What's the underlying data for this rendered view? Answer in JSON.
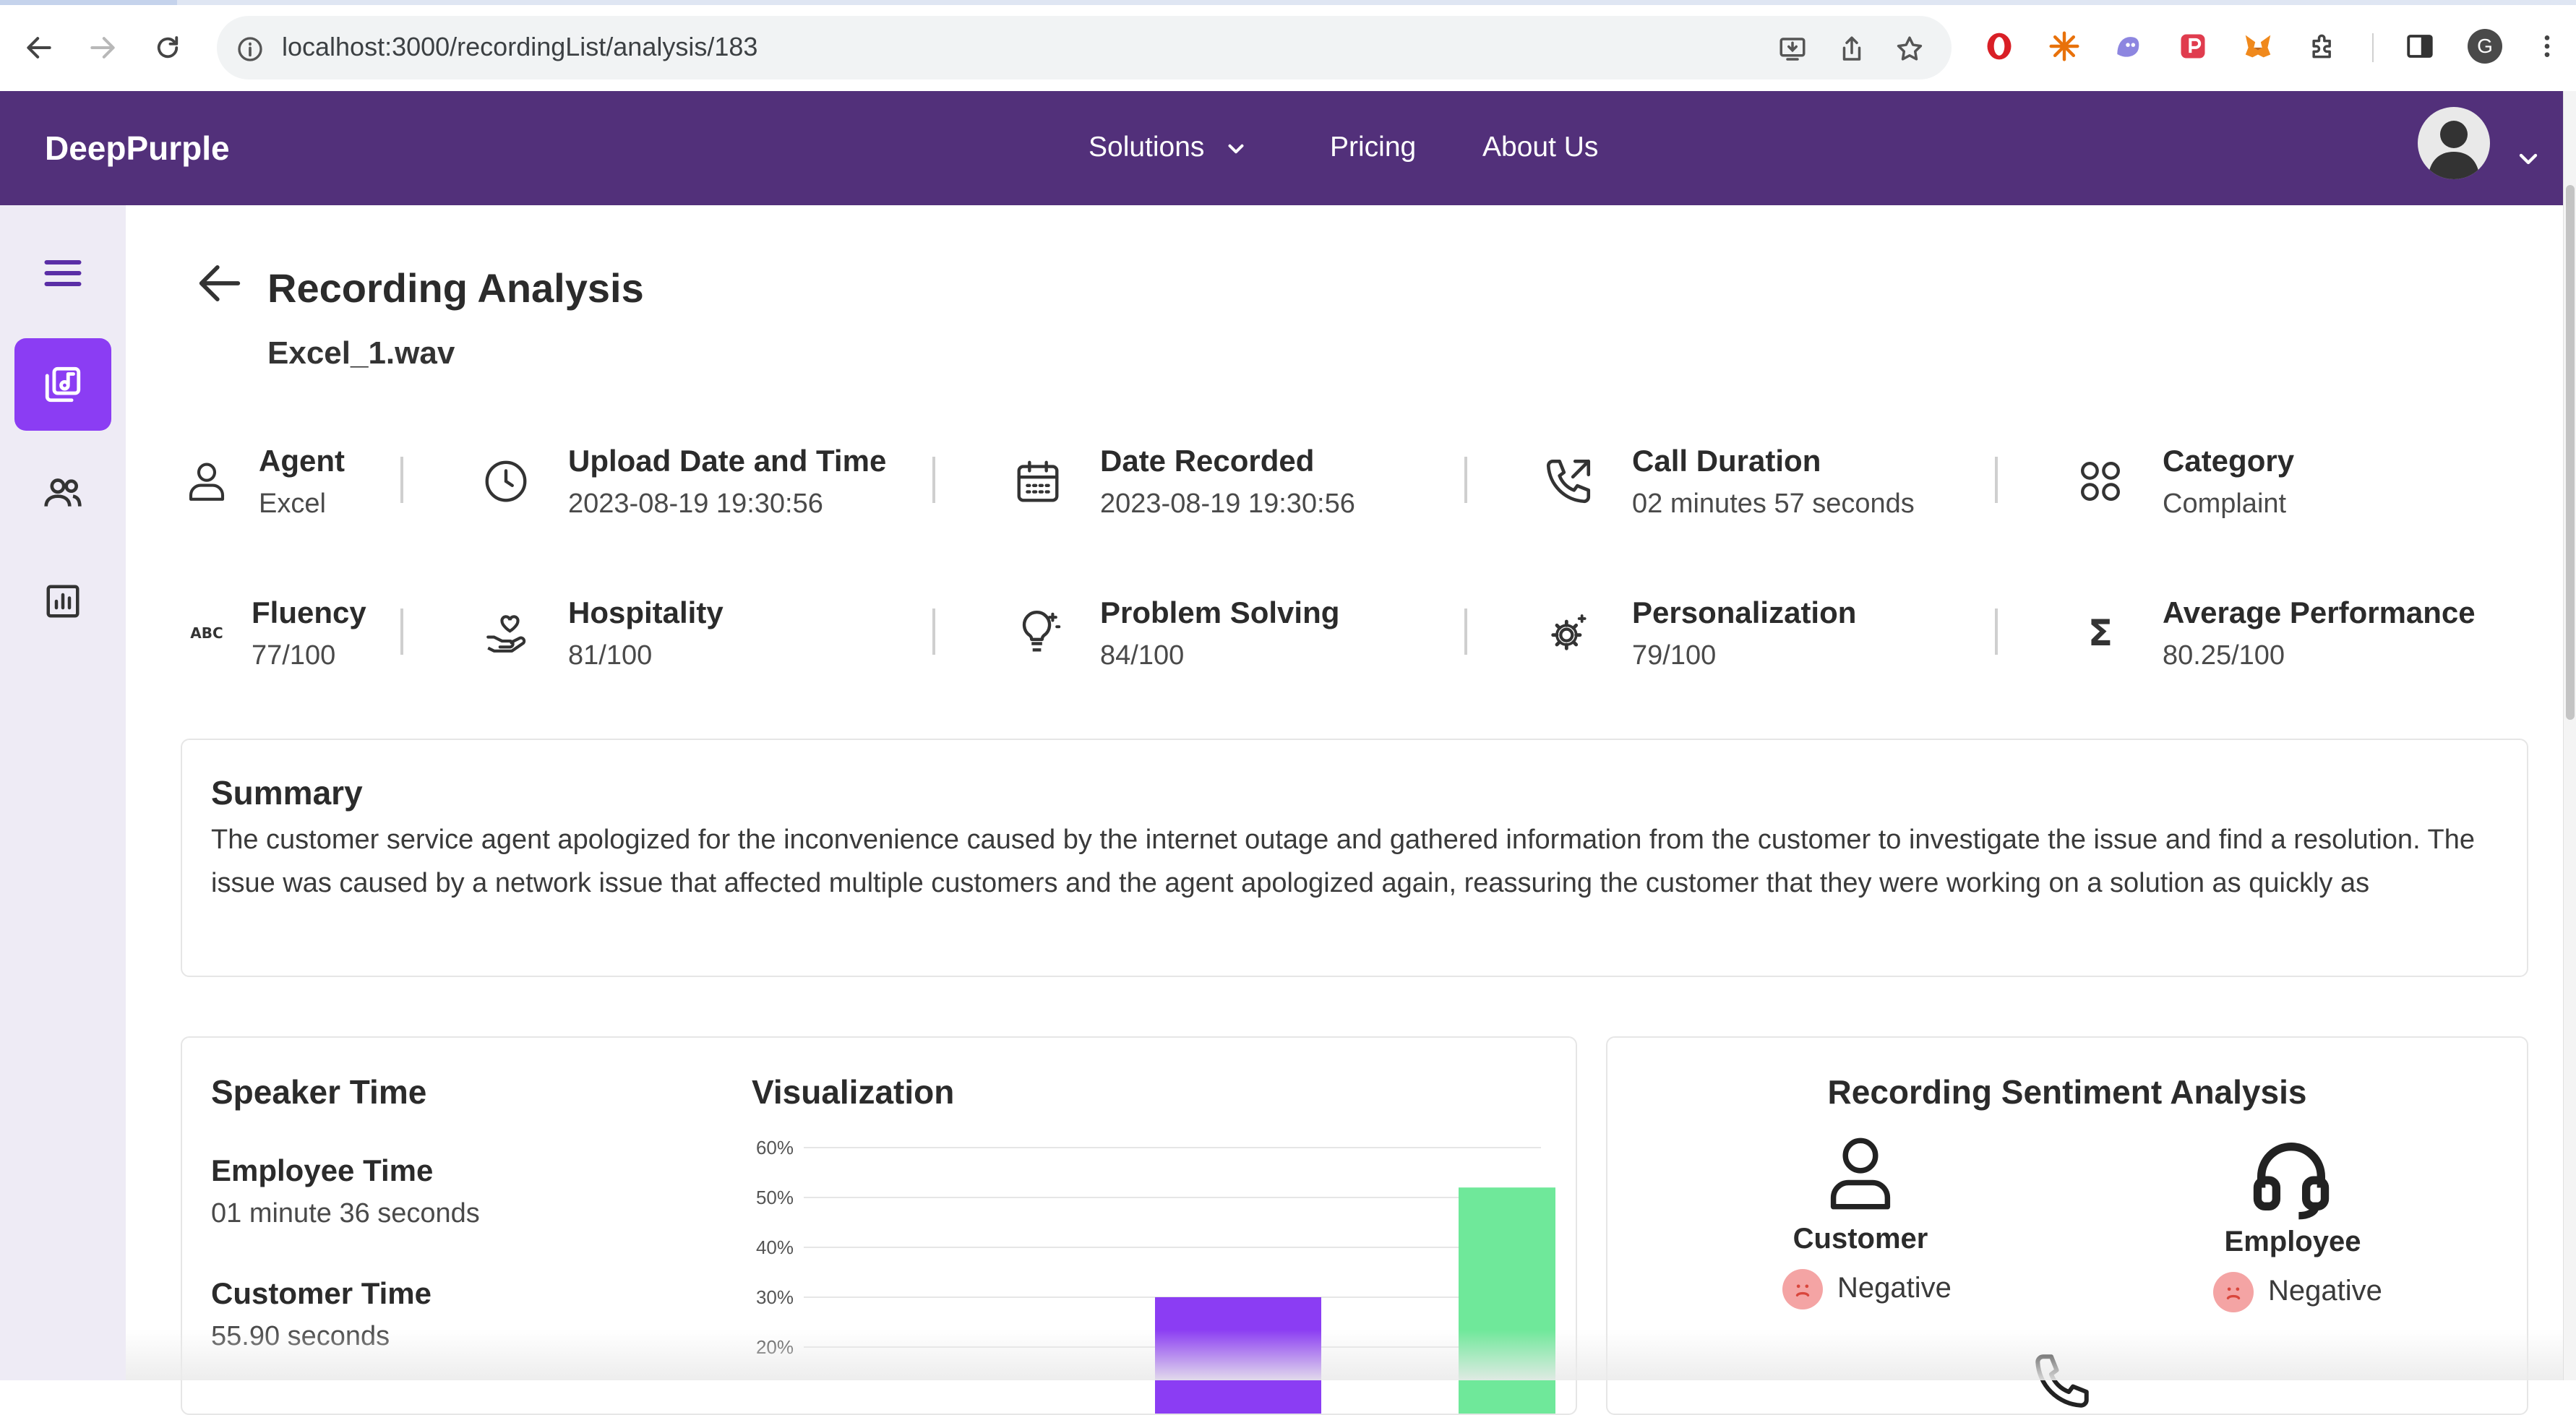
{
  "browser": {
    "url": "localhost:3000/recordingList/analysis/183",
    "profile_initial": "G"
  },
  "header": {
    "brand": "DeepPurple",
    "nav": [
      {
        "label": "Solutions"
      },
      {
        "label": "Pricing"
      },
      {
        "label": "About Us"
      }
    ]
  },
  "page": {
    "title": "Recording Analysis",
    "file_name": "Excel_1.wav"
  },
  "metrics_row1": [
    {
      "label": "Agent",
      "value": "Excel",
      "icon": "person-icon"
    },
    {
      "label": "Upload Date and Time",
      "value": "2023-08-19 19:30:56",
      "icon": "clock-icon"
    },
    {
      "label": "Date Recorded",
      "value": "2023-08-19 19:30:56",
      "icon": "calendar-icon"
    },
    {
      "label": "Call Duration",
      "value": "02 minutes 57 seconds",
      "icon": "phone-outgoing-icon"
    },
    {
      "label": "Category",
      "value": "Complaint",
      "icon": "category-icon"
    }
  ],
  "metrics_row2": [
    {
      "label": "Fluency",
      "value": "77/100",
      "icon": "abc-icon",
      "icon_text": "ABC"
    },
    {
      "label": "Hospitality",
      "value": "81/100",
      "icon": "hand-heart-icon"
    },
    {
      "label": "Problem Solving",
      "value": "84/100",
      "icon": "lightbulb-icon"
    },
    {
      "label": "Personalization",
      "value": "79/100",
      "icon": "settings-gear-icon"
    },
    {
      "label": "Average Performance",
      "value": "80.25/100",
      "icon": "sigma-icon",
      "icon_text": "Σ"
    }
  ],
  "summary": {
    "title": "Summary",
    "text": "The customer service agent apologized for the inconvenience caused by the internet outage and gathered information from the customer to investigate the issue and find a resolution. The issue was caused by a network issue that affected multiple customers and the agent apologized again, reassuring the customer that they were working on a solution as quickly as"
  },
  "speaker_time": {
    "title": "Speaker Time",
    "employee_label": "Employee Time",
    "employee_value": "01 minute 36 seconds",
    "customer_label": "Customer Time",
    "customer_value": "55.90 seconds"
  },
  "visualization": {
    "title": "Visualization"
  },
  "chart_data": {
    "type": "bar",
    "ylim": [
      0,
      60
    ],
    "ytick_labels": [
      "60%",
      "50%",
      "40%",
      "30%",
      "20%"
    ],
    "yticks": [
      60,
      50,
      40,
      30,
      20
    ],
    "bars": [
      {
        "value": 30,
        "color": "#8b3df3"
      },
      {
        "value": 52,
        "color": "#6fe89a"
      }
    ],
    "grid": true
  },
  "sentiment": {
    "title": "Recording Sentiment Analysis",
    "customer_label": "Customer",
    "customer_value": "Negative",
    "employee_label": "Employee",
    "employee_value": "Negative"
  },
  "colors": {
    "brand_purple": "#52307a",
    "accent_purple": "#8b3df3",
    "bar_green": "#6fe89a"
  }
}
